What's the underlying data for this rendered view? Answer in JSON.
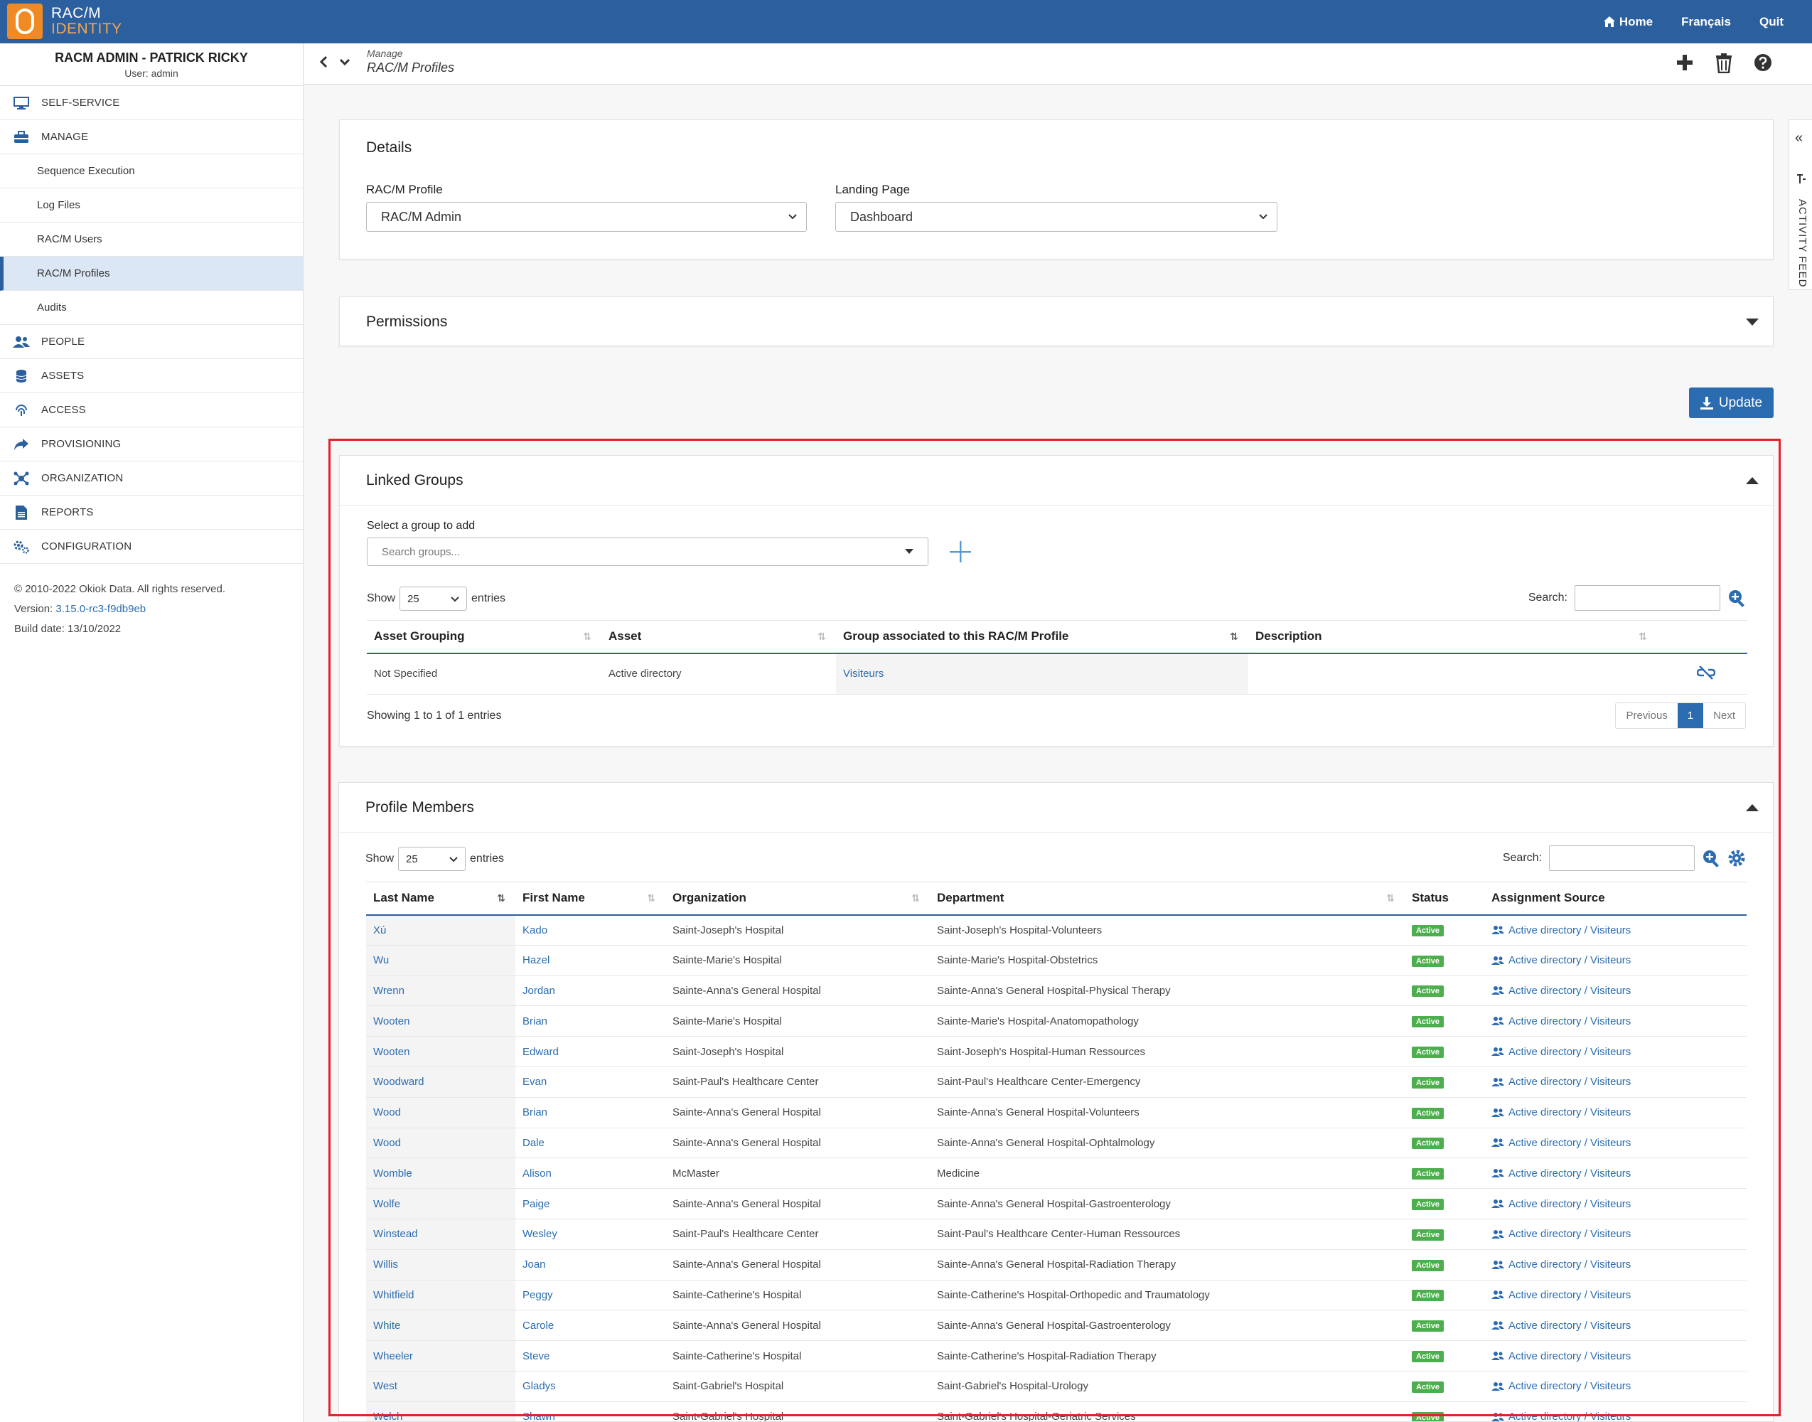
{
  "app": {
    "logo_line1": "RAC/M",
    "logo_line2": "IDENTITY",
    "nav": {
      "home": "Home",
      "language": "Français",
      "quit": "Quit"
    }
  },
  "sidebar": {
    "user_name": "RACM ADMIN - PATRICK RICKY",
    "user_login": "User: admin",
    "items": {
      "self_service": "SELF-SERVICE",
      "manage": "MANAGE",
      "sequence_execution": "Sequence Execution",
      "log_files": "Log Files",
      "racm_users": "RAC/M Users",
      "racm_profiles": "RAC/M Profiles",
      "audits": "Audits",
      "people": "PEOPLE",
      "assets": "ASSETS",
      "access": "ACCESS",
      "provisioning": "PROVISIONING",
      "organization": "ORGANIZATION",
      "reports": "REPORTS",
      "configuration": "CONFIGURATION"
    },
    "footer": {
      "copyright": "© 2010-2022 Okiok Data. All rights reserved.",
      "version_label": "Version:",
      "version": "3.15.0-rc3-f9db9eb",
      "build": "Build date: 13/10/2022"
    }
  },
  "header": {
    "crumb_parent": "Manage",
    "crumb_current": "RAC/M Profiles"
  },
  "activity_feed": "ACTIVITY FEED",
  "details": {
    "title": "Details",
    "profile_label": "RAC/M Profile",
    "profile_value": "RAC/M Admin",
    "landing_label": "Landing Page",
    "landing_value": "Dashboard"
  },
  "permissions": {
    "title": "Permissions"
  },
  "update_label": "Update",
  "linked_groups": {
    "title": "Linked Groups",
    "select_label": "Select a group to add",
    "search_placeholder": "Search groups...",
    "show_label": "Show",
    "entries_value": "25",
    "entries_label": "entries",
    "search_label": "Search:",
    "columns": [
      "Asset Grouping",
      "Asset",
      "Group associated to this RAC/M Profile",
      "Description"
    ],
    "rows": [
      {
        "grouping": "Not Specified",
        "asset": "Active directory",
        "group": "Visiteurs",
        "description": ""
      }
    ],
    "info": "Showing 1 to 1 of 1 entries",
    "pager": {
      "prev": "Previous",
      "page": "1",
      "next": "Next"
    }
  },
  "profile_members": {
    "title": "Profile Members",
    "show_label": "Show",
    "entries_value": "25",
    "entries_label": "entries",
    "search_label": "Search:",
    "columns": [
      "Last Name",
      "First Name",
      "Organization",
      "Department",
      "Status",
      "Assignment Source"
    ],
    "rows": [
      {
        "last": "Xú",
        "first": "Kado",
        "org": "Saint-Joseph's Hospital",
        "dept": "Saint-Joseph's Hospital-Volunteers",
        "status": "Active",
        "source": "Active directory / Visiteurs"
      },
      {
        "last": "Wu",
        "first": "Hazel",
        "org": "Sainte-Marie's Hospital",
        "dept": "Sainte-Marie's Hospital-Obstetrics",
        "status": "Active",
        "source": "Active directory / Visiteurs"
      },
      {
        "last": "Wrenn",
        "first": "Jordan",
        "org": "Sainte-Anna's General Hospital",
        "dept": "Sainte-Anna's General Hospital-Physical Therapy",
        "status": "Active",
        "source": "Active directory / Visiteurs"
      },
      {
        "last": "Wooten",
        "first": "Brian",
        "org": "Sainte-Marie's Hospital",
        "dept": "Sainte-Marie's Hospital-Anatomopathology",
        "status": "Active",
        "source": "Active directory / Visiteurs"
      },
      {
        "last": "Wooten",
        "first": "Edward",
        "org": "Saint-Joseph's Hospital",
        "dept": "Saint-Joseph's Hospital-Human Ressources",
        "status": "Active",
        "source": "Active directory / Visiteurs"
      },
      {
        "last": "Woodward",
        "first": "Evan",
        "org": "Saint-Paul's Healthcare Center",
        "dept": "Saint-Paul's Healthcare Center-Emergency",
        "status": "Active",
        "source": "Active directory / Visiteurs"
      },
      {
        "last": "Wood",
        "first": "Brian",
        "org": "Sainte-Anna's General Hospital",
        "dept": "Sainte-Anna's General Hospital-Volunteers",
        "status": "Active",
        "source": "Active directory / Visiteurs"
      },
      {
        "last": "Wood",
        "first": "Dale",
        "org": "Sainte-Anna's General Hospital",
        "dept": "Sainte-Anna's General Hospital-Ophtalmology",
        "status": "Active",
        "source": "Active directory / Visiteurs"
      },
      {
        "last": "Womble",
        "first": "Alison",
        "org": "McMaster",
        "dept": "Medicine",
        "status": "Active",
        "source": "Active directory / Visiteurs"
      },
      {
        "last": "Wolfe",
        "first": "Paige",
        "org": "Sainte-Anna's General Hospital",
        "dept": "Sainte-Anna's General Hospital-Gastroenterology",
        "status": "Active",
        "source": "Active directory / Visiteurs"
      },
      {
        "last": "Winstead",
        "first": "Wesley",
        "org": "Saint-Paul's Healthcare Center",
        "dept": "Saint-Paul's Healthcare Center-Human Ressources",
        "status": "Active",
        "source": "Active directory / Visiteurs"
      },
      {
        "last": "Willis",
        "first": "Joan",
        "org": "Sainte-Anna's General Hospital",
        "dept": "Sainte-Anna's General Hospital-Radiation Therapy",
        "status": "Active",
        "source": "Active directory / Visiteurs"
      },
      {
        "last": "Whitfield",
        "first": "Peggy",
        "org": "Sainte-Catherine's Hospital",
        "dept": "Sainte-Catherine's Hospital-Orthopedic and Traumatology",
        "status": "Active",
        "source": "Active directory / Visiteurs"
      },
      {
        "last": "White",
        "first": "Carole",
        "org": "Sainte-Anna's General Hospital",
        "dept": "Sainte-Anna's General Hospital-Gastroenterology",
        "status": "Active",
        "source": "Active directory / Visiteurs"
      },
      {
        "last": "Wheeler",
        "first": "Steve",
        "org": "Sainte-Catherine's Hospital",
        "dept": "Sainte-Catherine's Hospital-Radiation Therapy",
        "status": "Active",
        "source": "Active directory / Visiteurs"
      },
      {
        "last": "West",
        "first": "Gladys",
        "org": "Saint-Gabriel's Hospital",
        "dept": "Saint-Gabriel's Hospital-Urology",
        "status": "Active",
        "source": "Active directory / Visiteurs"
      },
      {
        "last": "Welch",
        "first": "Shawn",
        "org": "Saint-Gabriel's Hospital",
        "dept": "Saint-Gabriel's Hospital-Geriatric Services",
        "status": "Active",
        "source": "Active directory / Visiteurs"
      }
    ]
  },
  "colors": {
    "brand": "#2b5f9e",
    "accent": "#f08a24",
    "link": "#2b6cb0",
    "status_active": "#4cae4c",
    "highlight": "#e5202a"
  },
  "icons": [
    "home-icon",
    "monitor-icon",
    "toolbox-icon",
    "people-icon",
    "database-icon",
    "fingerprint-icon",
    "share-icon",
    "org-icon",
    "report-icon",
    "gears-icon",
    "plus-icon",
    "trash-icon",
    "help-icon",
    "download-icon",
    "unlink-icon",
    "search-plus-icon",
    "gear-icon",
    "users-icon"
  ]
}
